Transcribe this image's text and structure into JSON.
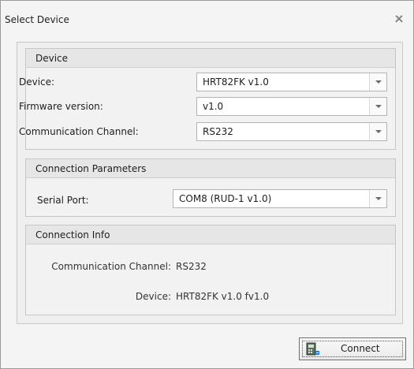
{
  "window": {
    "title": "Select Device",
    "close_icon": "close-icon"
  },
  "device_group": {
    "header": "Device",
    "device_label": "Device:",
    "device_value": "HRT82FK v1.0",
    "firmware_label": "Firmware version:",
    "firmware_value": "v1.0",
    "channel_label": "Communication Channel:",
    "channel_value": "RS232"
  },
  "connection_params": {
    "header": "Connection Parameters",
    "serial_port_label": "Serial Port:",
    "serial_port_value": "COM8 (RUD-1 v1.0)"
  },
  "connection_info": {
    "header": "Connection Info",
    "channel_label": "Communication Channel:",
    "channel_value": "RS232",
    "device_label": "Device:",
    "device_value": "HRT82FK v1.0 fv1.0"
  },
  "footer": {
    "connect_label": "Connect",
    "connect_icon": "device-connect-icon"
  }
}
